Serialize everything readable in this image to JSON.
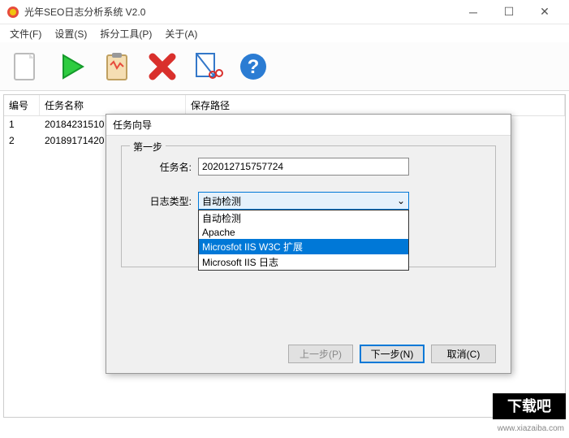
{
  "window": {
    "title": "光年SEO日志分析系统 V2.0"
  },
  "menu": {
    "file": "文件(F)",
    "settings": "设置(S)",
    "tools": "拆分工具(P)",
    "about": "关于(A)"
  },
  "table": {
    "headers": {
      "id": "编号",
      "name": "任务名称",
      "path": "保存路径"
    },
    "rows": [
      {
        "id": "1",
        "name": "20184231510"
      },
      {
        "id": "2",
        "name": "20189171420"
      }
    ]
  },
  "dialog": {
    "title": "任务向导",
    "step_label": "第一步",
    "task_label": "任务名:",
    "task_value": "202012715757724",
    "type_label": "日志类型:",
    "combo_value": "自动检测",
    "options": [
      "自动检测",
      "Apache",
      "Microsfot IIS W3C 扩展",
      "Microsoft IIS 日志"
    ],
    "prev": "上一步(P)",
    "next": "下一步(N)",
    "cancel": "取消(C)"
  },
  "watermark": "www.xiazaiba.com"
}
